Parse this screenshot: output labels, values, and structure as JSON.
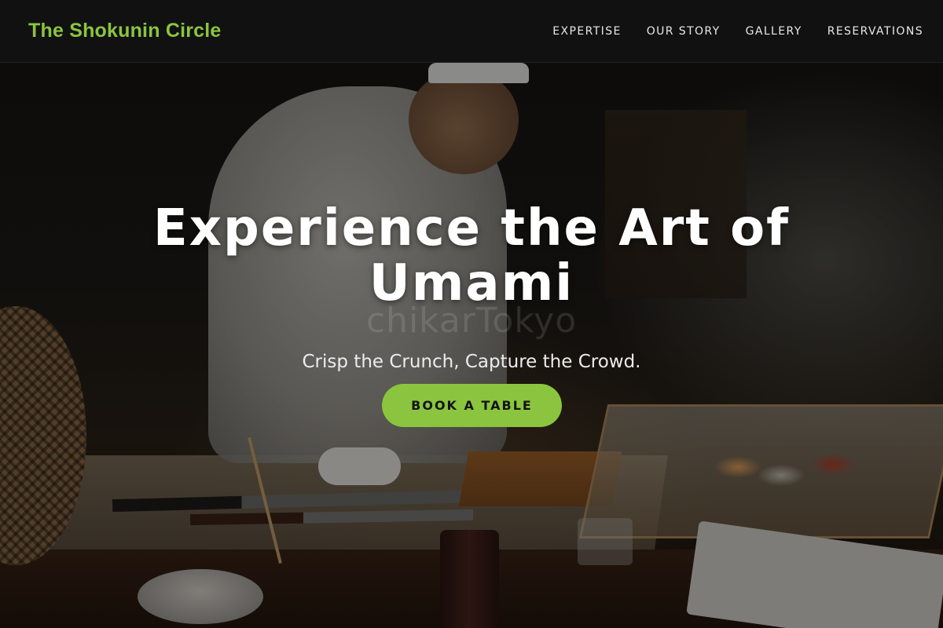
{
  "header": {
    "brand": "The Shokunin Circle",
    "nav": [
      {
        "label": "EXPERTISE"
      },
      {
        "label": "OUR STORY"
      },
      {
        "label": "GALLERY"
      },
      {
        "label": "RESERVATIONS"
      }
    ]
  },
  "hero": {
    "watermark": "chikarTokyo",
    "title": "Experience the Art of Umami",
    "subtitle": "Crisp the Crunch, Capture the Crowd.",
    "cta_label": "BOOK A TABLE",
    "background_image": "chef-preparing-sushi-at-counter"
  },
  "colors": {
    "accent": "#8bc53f",
    "header_bg": "#121212",
    "title_text": "#ffffff",
    "cta_text": "#141414"
  }
}
